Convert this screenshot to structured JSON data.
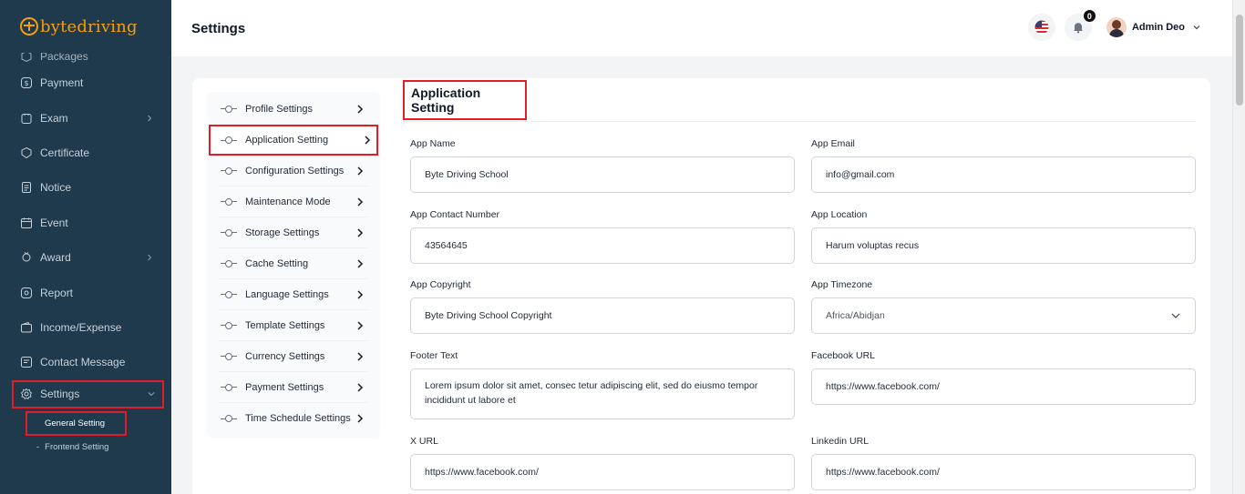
{
  "brand": {
    "logo_byte": "byte",
    "logo_driving": "driving"
  },
  "sidebar": {
    "items": [
      {
        "label": "Packages",
        "icon": "package-icon"
      },
      {
        "label": "Payment",
        "icon": "payment-icon"
      },
      {
        "label": "Exam",
        "icon": "exam-icon",
        "has_children": true
      },
      {
        "label": "Certificate",
        "icon": "certificate-icon"
      },
      {
        "label": "Notice",
        "icon": "notice-icon"
      },
      {
        "label": "Event",
        "icon": "calendar-icon"
      },
      {
        "label": "Award",
        "icon": "award-icon",
        "has_children": true
      },
      {
        "label": "Report",
        "icon": "report-icon"
      },
      {
        "label": "Income/Expense",
        "icon": "wallet-icon"
      },
      {
        "label": "Contact Message",
        "icon": "message-icon"
      },
      {
        "label": "Settings",
        "icon": "gear-icon",
        "expanded": true
      }
    ],
    "sub_items": [
      {
        "label": "General Setting"
      },
      {
        "label": "Frontend Setting"
      }
    ]
  },
  "header": {
    "title": "Settings",
    "notification_count": "0",
    "user_name": "Admin Deo"
  },
  "settings_menu": [
    {
      "label": "Profile Settings"
    },
    {
      "label": "Application Setting"
    },
    {
      "label": "Configuration Settings"
    },
    {
      "label": "Maintenance Mode"
    },
    {
      "label": "Storage Settings"
    },
    {
      "label": "Cache Setting"
    },
    {
      "label": "Language Settings"
    },
    {
      "label": "Template Settings"
    },
    {
      "label": "Currency Settings"
    },
    {
      "label": "Payment Settings"
    },
    {
      "label": "Time Schedule Settings"
    }
  ],
  "form": {
    "title": "Application Setting",
    "app_name_label": "App Name",
    "app_name_value": "Byte Driving School",
    "app_email_label": "App Email",
    "app_email_value": "info@gmail.com",
    "contact_label": "App Contact Number",
    "contact_value": "43564645",
    "location_label": "App Location",
    "location_value": "Harum voluptas recus",
    "copyright_label": "App Copyright",
    "copyright_value": "Byte Driving School Copyright",
    "timezone_label": "App Timezone",
    "timezone_value": "Africa/Abidjan",
    "footer_label": "Footer Text",
    "footer_value": "Lorem ipsum dolor sit amet, consec tetur adipiscing elit, sed do eiusmo tempor incididunt ut labore et",
    "facebook_label": "Facebook URL",
    "facebook_value": "https://www.facebook.com/",
    "x_label": "X URL",
    "x_value": "https://www.facebook.com/",
    "linkedin_label": "Linkedin URL",
    "linkedin_value": "https://www.facebook.com/"
  },
  "colors": {
    "sidebar_bg": "#1e3a4c",
    "brand": "#f59e0b",
    "highlight": "#e11d2a"
  }
}
